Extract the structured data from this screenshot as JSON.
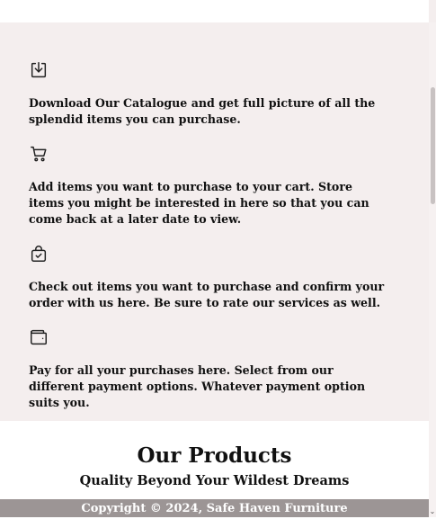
{
  "features": [
    {
      "icon": "download-icon",
      "text": "Download Our Catalogue and get full picture of all the splendid items you can purchase."
    },
    {
      "icon": "cart-icon",
      "text": "Add items you want to purchase to your cart. Store items you might be interested in here so that you can come back at a later date to view."
    },
    {
      "icon": "shopping-bag-check-icon",
      "text": "Check out items you want to purchase and confirm your order with us here. Be sure to rate our services as well."
    },
    {
      "icon": "wallet-icon",
      "text": "Pay for all your purchases here. Select from our different payment options. Whatever payment option suits you."
    }
  ],
  "products": {
    "title": "Our Products",
    "subtitle": "Quality Beyond Your Wildest Dreams"
  },
  "footer": {
    "copyright": "Copyright © 2024, Safe Haven Furniture"
  },
  "scrollbar": {
    "down_arrow": "⌄"
  }
}
